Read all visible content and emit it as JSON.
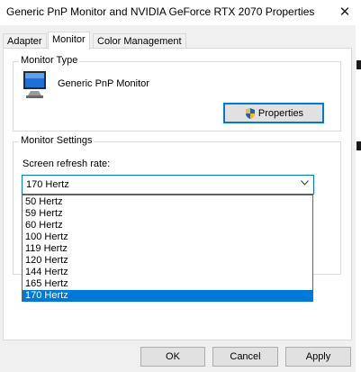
{
  "window": {
    "title": "Generic PnP Monitor and NVIDIA GeForce RTX 2070 Properties",
    "close_icon": "close-icon"
  },
  "tabs": [
    {
      "label": "Adapter",
      "active": false
    },
    {
      "label": "Monitor",
      "active": true
    },
    {
      "label": "Color Management",
      "active": false
    }
  ],
  "monitor_type": {
    "group_label": "Monitor Type",
    "monitor_name": "Generic PnP Monitor",
    "icon": "monitor-icon",
    "properties_button": "Properties",
    "properties_icon": "shield-icon"
  },
  "monitor_settings": {
    "group_label": "Monitor Settings",
    "refresh_label": "Screen refresh rate:",
    "selected_rate": "170 Hertz",
    "options": [
      "50 Hertz",
      "59 Hertz",
      "60 Hertz",
      "100 Hertz",
      "119 Hertz",
      "120 Hertz",
      "144 Hertz",
      "165 Hertz",
      "170 Hertz"
    ]
  },
  "footer": {
    "ok": "OK",
    "cancel": "Cancel",
    "apply": "Apply"
  },
  "colors": {
    "accent": "#0078d7",
    "window_bg": "#f0f0f0",
    "button_bg": "#e1e1e1"
  }
}
